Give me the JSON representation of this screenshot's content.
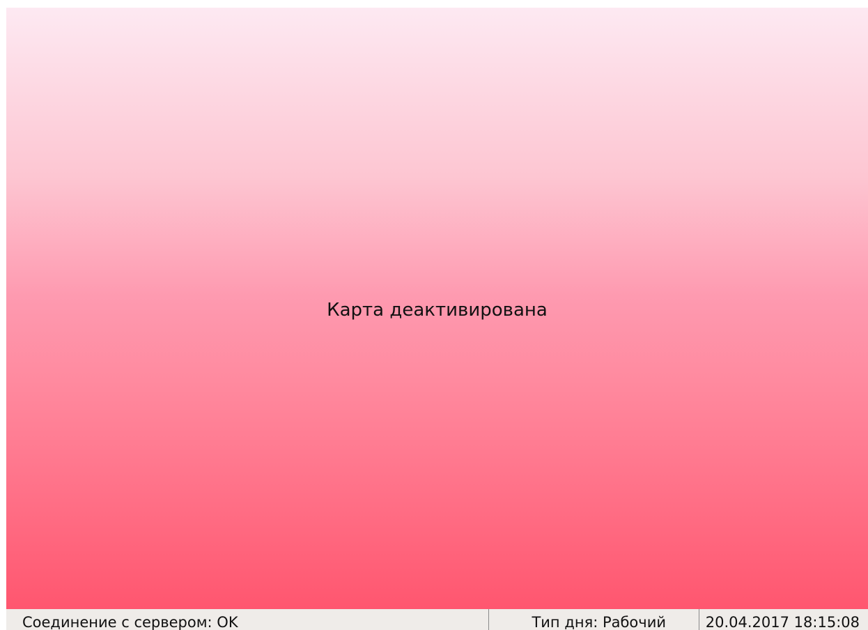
{
  "main": {
    "message": "Карта деактивирована",
    "background_colors": [
      "#fde9f2",
      "#fdc6d2",
      "#fe9ab0",
      "#ff8a9f",
      "#ff6f86",
      "#ff566f"
    ]
  },
  "status_bar": {
    "server_connection": "Соединение с сервером: OK",
    "day_type": "Тип дня: Рабочий",
    "datetime": "20.04.2017 18:15:08",
    "background_color": "#efece9"
  }
}
